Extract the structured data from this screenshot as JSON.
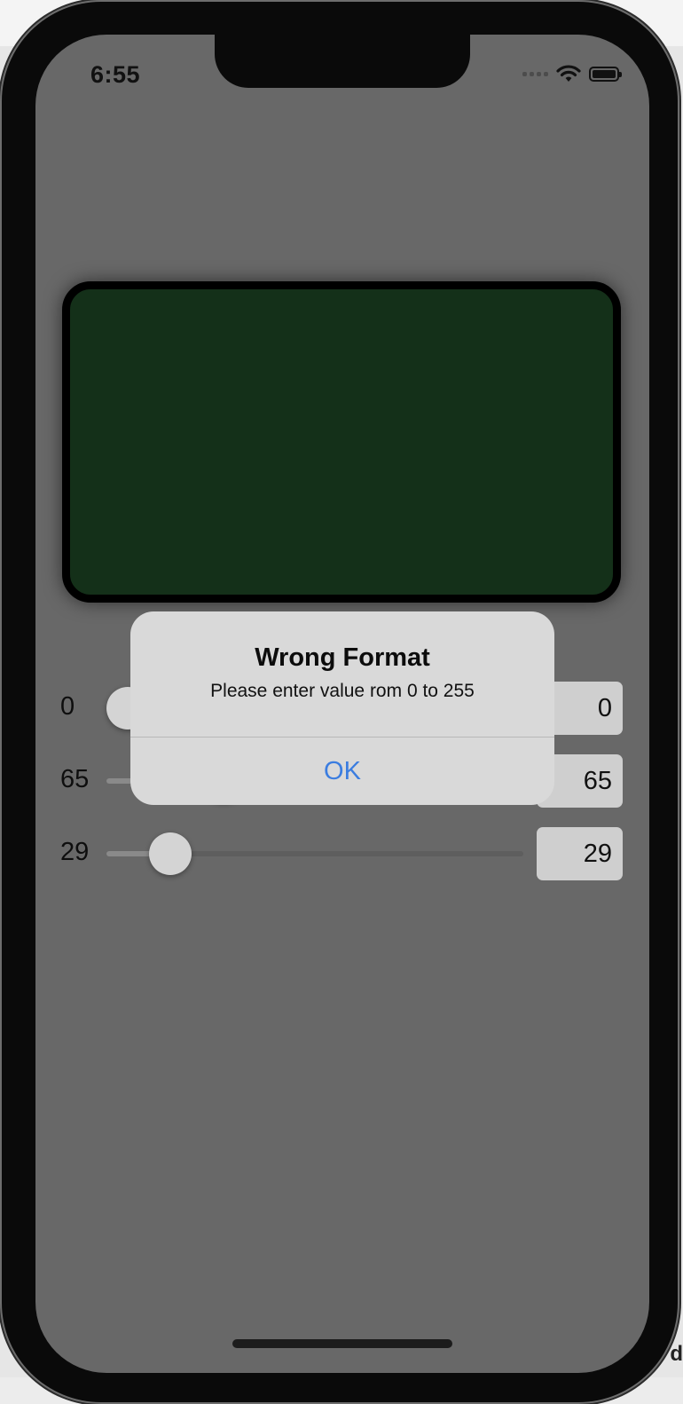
{
  "status_bar": {
    "time": "6:55",
    "signal_icon": "cellular-dots-icon",
    "wifi_icon": "wifi-icon",
    "battery_icon": "battery-icon"
  },
  "color_preview": {
    "color": "#143019"
  },
  "sliders": [
    {
      "label": "0",
      "value": 0,
      "max": 255,
      "field_value": "0"
    },
    {
      "label": "65",
      "value": 65,
      "max": 255,
      "field_value": "65"
    },
    {
      "label": "29",
      "value": 29,
      "max": 255,
      "field_value": "29"
    }
  ],
  "alert": {
    "title": "Wrong Format",
    "message": "Please enter value rom 0 to 255",
    "ok_label": "OK"
  },
  "colors": {
    "accent": "#3b7de0",
    "dim_background": "#686868"
  },
  "edge_text": "d"
}
